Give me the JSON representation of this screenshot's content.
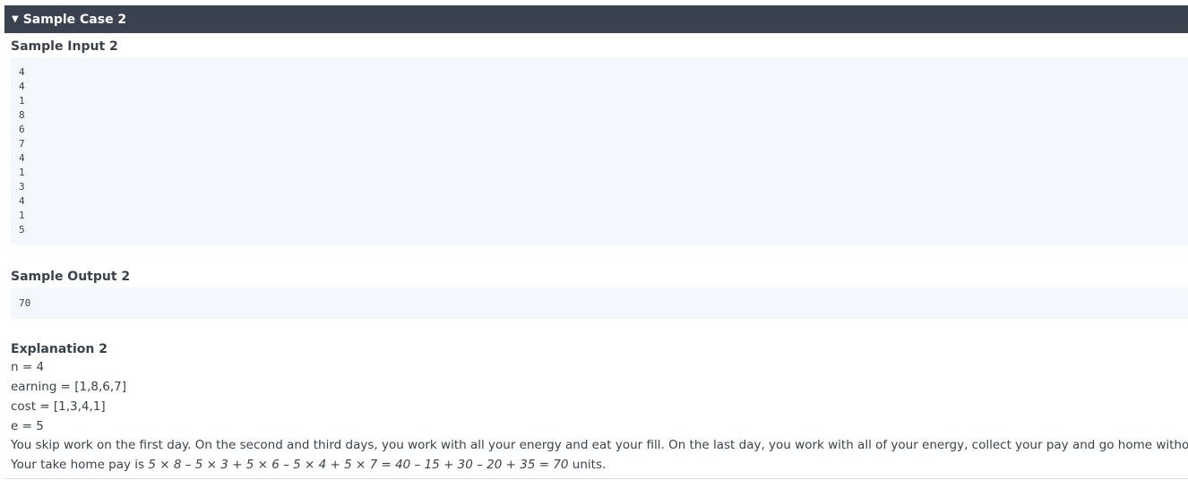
{
  "header": {
    "toggle_icon": "▼",
    "title": "Sample Case 2"
  },
  "sample_input": {
    "title": "Sample Input 2",
    "lines": [
      "4",
      "4",
      "1",
      "8",
      "6",
      "7",
      "4",
      "1",
      "3",
      "4",
      "1",
      "5"
    ]
  },
  "sample_output": {
    "title": "Sample Output 2",
    "value": "70"
  },
  "explanation": {
    "title": "Explanation 2",
    "n_line": "n = 4",
    "earning_line": "earning = [1,8,6,7]",
    "cost_line": "cost = [1,3,4,1]",
    "e_line": "e = 5",
    "paragraph": "You skip work on the first day. On the second and third days, you work with all your energy and eat your fill. On the last day, you work with all of your energy, collect your pay and go home without eating.",
    "pay_prefix": "Your take home pay is ",
    "pay_formula": "5 × 8 – 5 × 3 + 5 × 6 – 5 × 4 + 5 × 7 = 40 – 15 + 30 – 20 + 35 = 70",
    "pay_suffix": " units."
  },
  "colors": {
    "header_bg": "#39424e",
    "code_bg": "#f3f7fe",
    "text": "#39424e"
  }
}
